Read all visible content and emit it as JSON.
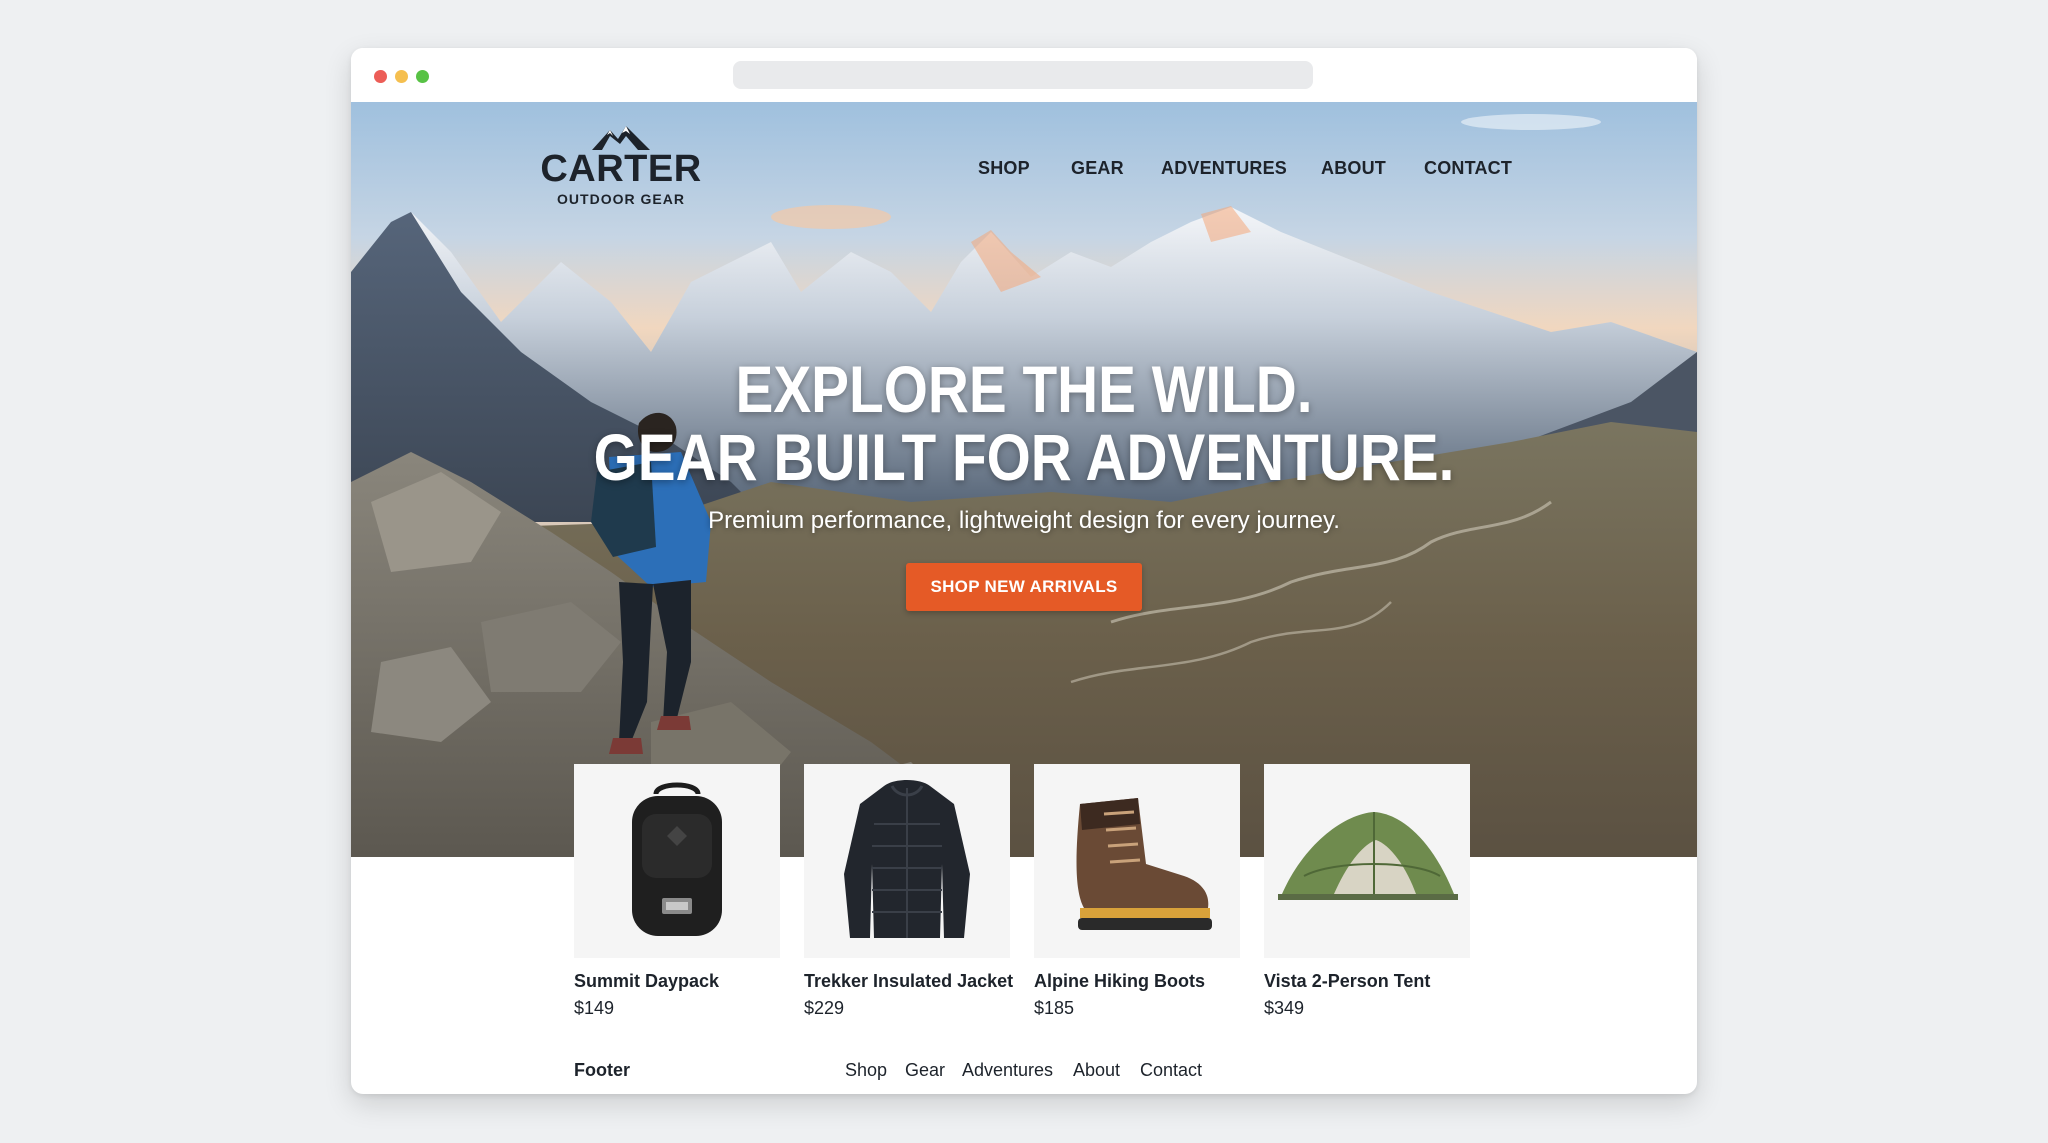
{
  "brand": {
    "name": "CARTER",
    "tagline": "OUTDOOR GEAR"
  },
  "nav": {
    "items": [
      {
        "label": "SHOP"
      },
      {
        "label": "GEAR"
      },
      {
        "label": "ADVENTURES"
      },
      {
        "label": "ABOUT"
      },
      {
        "label": "CONTACT"
      }
    ]
  },
  "hero": {
    "headline_line1": "EXPLORE THE WILD.",
    "headline_line2": "GEAR BUILT FOR ADVENTURE.",
    "subtitle": "Premium performance, lightweight design for every journey.",
    "cta_label": "SHOP NEW ARRIVALS"
  },
  "products": [
    {
      "name": "Summit Daypack",
      "price": "$149",
      "icon": "backpack-icon"
    },
    {
      "name": "Trekker Insulated Jacket",
      "price": "$229",
      "icon": "jacket-icon"
    },
    {
      "name": "Alpine Hiking Boots",
      "price": "$185",
      "icon": "boot-icon"
    },
    {
      "name": "Vista 2-Person Tent",
      "price": "$349",
      "icon": "tent-icon"
    }
  ],
  "footer": {
    "label": "Footer",
    "links": [
      {
        "label": "Shop"
      },
      {
        "label": "Gear"
      },
      {
        "label": "Adventures"
      },
      {
        "label": "About"
      },
      {
        "label": "Contact"
      }
    ]
  },
  "colors": {
    "accent": "#e55a26",
    "text_dark": "#1d232b",
    "window_close": "#ec5d57",
    "window_minimize": "#f5bf4f",
    "window_maximize": "#58c245"
  }
}
